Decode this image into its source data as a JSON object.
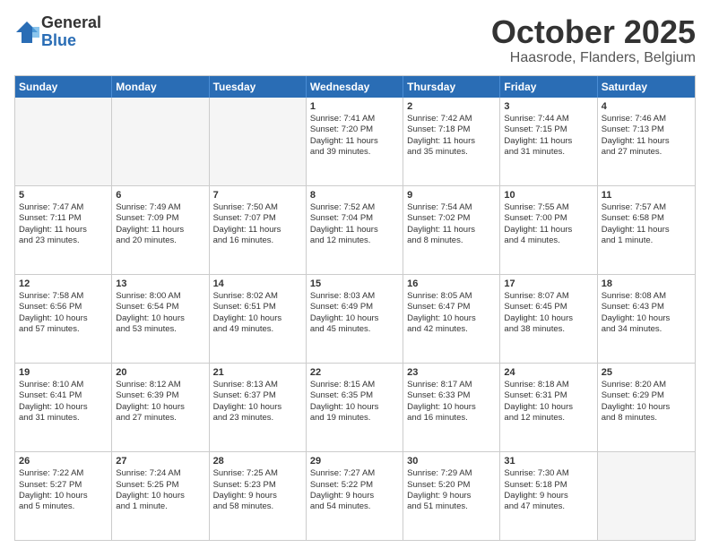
{
  "header": {
    "logo": {
      "general": "General",
      "blue": "Blue"
    },
    "month": "October 2025",
    "location": "Haasrode, Flanders, Belgium"
  },
  "weekdays": [
    "Sunday",
    "Monday",
    "Tuesday",
    "Wednesday",
    "Thursday",
    "Friday",
    "Saturday"
  ],
  "rows": [
    [
      {
        "day": "",
        "lines": [],
        "empty": true
      },
      {
        "day": "",
        "lines": [],
        "empty": true
      },
      {
        "day": "",
        "lines": [],
        "empty": true
      },
      {
        "day": "1",
        "lines": [
          "Sunrise: 7:41 AM",
          "Sunset: 7:20 PM",
          "Daylight: 11 hours",
          "and 39 minutes."
        ]
      },
      {
        "day": "2",
        "lines": [
          "Sunrise: 7:42 AM",
          "Sunset: 7:18 PM",
          "Daylight: 11 hours",
          "and 35 minutes."
        ]
      },
      {
        "day": "3",
        "lines": [
          "Sunrise: 7:44 AM",
          "Sunset: 7:15 PM",
          "Daylight: 11 hours",
          "and 31 minutes."
        ]
      },
      {
        "day": "4",
        "lines": [
          "Sunrise: 7:46 AM",
          "Sunset: 7:13 PM",
          "Daylight: 11 hours",
          "and 27 minutes."
        ]
      }
    ],
    [
      {
        "day": "5",
        "lines": [
          "Sunrise: 7:47 AM",
          "Sunset: 7:11 PM",
          "Daylight: 11 hours",
          "and 23 minutes."
        ]
      },
      {
        "day": "6",
        "lines": [
          "Sunrise: 7:49 AM",
          "Sunset: 7:09 PM",
          "Daylight: 11 hours",
          "and 20 minutes."
        ]
      },
      {
        "day": "7",
        "lines": [
          "Sunrise: 7:50 AM",
          "Sunset: 7:07 PM",
          "Daylight: 11 hours",
          "and 16 minutes."
        ]
      },
      {
        "day": "8",
        "lines": [
          "Sunrise: 7:52 AM",
          "Sunset: 7:04 PM",
          "Daylight: 11 hours",
          "and 12 minutes."
        ]
      },
      {
        "day": "9",
        "lines": [
          "Sunrise: 7:54 AM",
          "Sunset: 7:02 PM",
          "Daylight: 11 hours",
          "and 8 minutes."
        ]
      },
      {
        "day": "10",
        "lines": [
          "Sunrise: 7:55 AM",
          "Sunset: 7:00 PM",
          "Daylight: 11 hours",
          "and 4 minutes."
        ]
      },
      {
        "day": "11",
        "lines": [
          "Sunrise: 7:57 AM",
          "Sunset: 6:58 PM",
          "Daylight: 11 hours",
          "and 1 minute."
        ]
      }
    ],
    [
      {
        "day": "12",
        "lines": [
          "Sunrise: 7:58 AM",
          "Sunset: 6:56 PM",
          "Daylight: 10 hours",
          "and 57 minutes."
        ]
      },
      {
        "day": "13",
        "lines": [
          "Sunrise: 8:00 AM",
          "Sunset: 6:54 PM",
          "Daylight: 10 hours",
          "and 53 minutes."
        ]
      },
      {
        "day": "14",
        "lines": [
          "Sunrise: 8:02 AM",
          "Sunset: 6:51 PM",
          "Daylight: 10 hours",
          "and 49 minutes."
        ]
      },
      {
        "day": "15",
        "lines": [
          "Sunrise: 8:03 AM",
          "Sunset: 6:49 PM",
          "Daylight: 10 hours",
          "and 45 minutes."
        ]
      },
      {
        "day": "16",
        "lines": [
          "Sunrise: 8:05 AM",
          "Sunset: 6:47 PM",
          "Daylight: 10 hours",
          "and 42 minutes."
        ]
      },
      {
        "day": "17",
        "lines": [
          "Sunrise: 8:07 AM",
          "Sunset: 6:45 PM",
          "Daylight: 10 hours",
          "and 38 minutes."
        ]
      },
      {
        "day": "18",
        "lines": [
          "Sunrise: 8:08 AM",
          "Sunset: 6:43 PM",
          "Daylight: 10 hours",
          "and 34 minutes."
        ]
      }
    ],
    [
      {
        "day": "19",
        "lines": [
          "Sunrise: 8:10 AM",
          "Sunset: 6:41 PM",
          "Daylight: 10 hours",
          "and 31 minutes."
        ]
      },
      {
        "day": "20",
        "lines": [
          "Sunrise: 8:12 AM",
          "Sunset: 6:39 PM",
          "Daylight: 10 hours",
          "and 27 minutes."
        ]
      },
      {
        "day": "21",
        "lines": [
          "Sunrise: 8:13 AM",
          "Sunset: 6:37 PM",
          "Daylight: 10 hours",
          "and 23 minutes."
        ]
      },
      {
        "day": "22",
        "lines": [
          "Sunrise: 8:15 AM",
          "Sunset: 6:35 PM",
          "Daylight: 10 hours",
          "and 19 minutes."
        ]
      },
      {
        "day": "23",
        "lines": [
          "Sunrise: 8:17 AM",
          "Sunset: 6:33 PM",
          "Daylight: 10 hours",
          "and 16 minutes."
        ]
      },
      {
        "day": "24",
        "lines": [
          "Sunrise: 8:18 AM",
          "Sunset: 6:31 PM",
          "Daylight: 10 hours",
          "and 12 minutes."
        ]
      },
      {
        "day": "25",
        "lines": [
          "Sunrise: 8:20 AM",
          "Sunset: 6:29 PM",
          "Daylight: 10 hours",
          "and 8 minutes."
        ]
      }
    ],
    [
      {
        "day": "26",
        "lines": [
          "Sunrise: 7:22 AM",
          "Sunset: 5:27 PM",
          "Daylight: 10 hours",
          "and 5 minutes."
        ]
      },
      {
        "day": "27",
        "lines": [
          "Sunrise: 7:24 AM",
          "Sunset: 5:25 PM",
          "Daylight: 10 hours",
          "and 1 minute."
        ]
      },
      {
        "day": "28",
        "lines": [
          "Sunrise: 7:25 AM",
          "Sunset: 5:23 PM",
          "Daylight: 9 hours",
          "and 58 minutes."
        ]
      },
      {
        "day": "29",
        "lines": [
          "Sunrise: 7:27 AM",
          "Sunset: 5:22 PM",
          "Daylight: 9 hours",
          "and 54 minutes."
        ]
      },
      {
        "day": "30",
        "lines": [
          "Sunrise: 7:29 AM",
          "Sunset: 5:20 PM",
          "Daylight: 9 hours",
          "and 51 minutes."
        ]
      },
      {
        "day": "31",
        "lines": [
          "Sunrise: 7:30 AM",
          "Sunset: 5:18 PM",
          "Daylight: 9 hours",
          "and 47 minutes."
        ]
      },
      {
        "day": "",
        "lines": [],
        "empty": true
      }
    ]
  ]
}
